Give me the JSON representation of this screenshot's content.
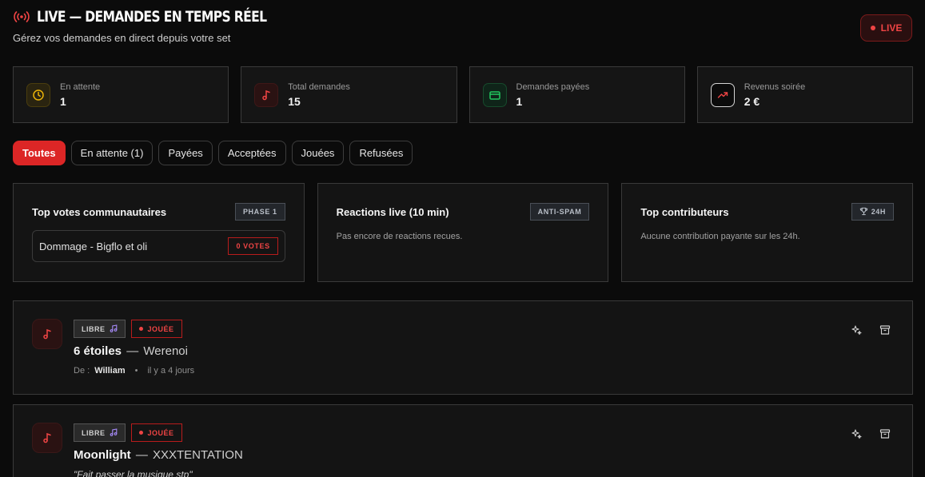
{
  "header": {
    "title": "LIVE — DEMANDES EN TEMPS RÉEL",
    "subtitle": "Gérez vos demandes en direct depuis votre set",
    "live_badge": "LIVE",
    "live_icon": "broadcast-icon"
  },
  "stats": [
    {
      "label": "En attente",
      "value": "1",
      "icon": "clock-icon",
      "color": "#eab308"
    },
    {
      "label": "Total demandes",
      "value": "15",
      "icon": "music-note-icon",
      "color": "#ef4444"
    },
    {
      "label": "Demandes payées",
      "value": "1",
      "icon": "credit-card-icon",
      "color": "#22c55e"
    },
    {
      "label": "Revenus soirée",
      "value": "2 €",
      "icon": "trending-up-icon",
      "color": "#ef4444"
    }
  ],
  "filters": [
    "Toutes",
    "En attente (1)",
    "Payées",
    "Acceptées",
    "Jouées",
    "Refusées"
  ],
  "active_filter": "Toutes",
  "panels": {
    "votes": {
      "title": "Top votes communautaires",
      "tag": "PHASE 1",
      "item_song": "Dommage - Bigflo et oli",
      "item_votes": "0 VOTES"
    },
    "reactions": {
      "title": "Reactions live (10 min)",
      "tag": "ANTI-SPAM",
      "text": "Pas encore de reactions recues."
    },
    "contributors": {
      "title": "Top contributeurs",
      "tag": "24H",
      "tag_icon": "trophy-icon",
      "text": "Aucune contribution payante sur les 24h."
    }
  },
  "requests": [
    {
      "type_badge": "LIBRE",
      "status_badge": "JOUÉE",
      "title": "6 étoiles",
      "separator": "—",
      "artist": "Werenoi",
      "from_label": "De :",
      "from_name": "William",
      "bullet": "•",
      "time": "il y a 4 jours",
      "message": ""
    },
    {
      "type_badge": "LIBRE",
      "status_badge": "JOUÉE",
      "title": "Moonlight",
      "separator": "—",
      "artist": "XXXTENTATION",
      "from_label": "",
      "from_name": "",
      "bullet": "",
      "time": "",
      "message": "\"Fait passer la musique stp\""
    }
  ],
  "colors": {
    "accent": "#dc2626",
    "background": "#0b0b0b",
    "card": "#151515",
    "border": "#3a3a3a"
  }
}
